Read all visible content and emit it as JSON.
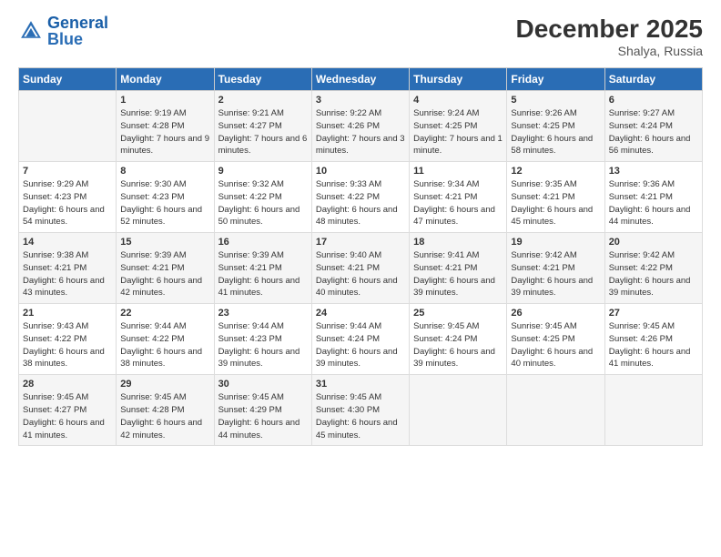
{
  "header": {
    "logo_general": "General",
    "logo_blue": "Blue",
    "main_title": "December 2025",
    "subtitle": "Shalya, Russia"
  },
  "columns": [
    "Sunday",
    "Monday",
    "Tuesday",
    "Wednesday",
    "Thursday",
    "Friday",
    "Saturday"
  ],
  "weeks": [
    [
      {
        "day": "",
        "sunrise": "",
        "sunset": "",
        "daylight": ""
      },
      {
        "day": "1",
        "sunrise": "Sunrise: 9:19 AM",
        "sunset": "Sunset: 4:28 PM",
        "daylight": "Daylight: 7 hours and 9 minutes."
      },
      {
        "day": "2",
        "sunrise": "Sunrise: 9:21 AM",
        "sunset": "Sunset: 4:27 PM",
        "daylight": "Daylight: 7 hours and 6 minutes."
      },
      {
        "day": "3",
        "sunrise": "Sunrise: 9:22 AM",
        "sunset": "Sunset: 4:26 PM",
        "daylight": "Daylight: 7 hours and 3 minutes."
      },
      {
        "day": "4",
        "sunrise": "Sunrise: 9:24 AM",
        "sunset": "Sunset: 4:25 PM",
        "daylight": "Daylight: 7 hours and 1 minute."
      },
      {
        "day": "5",
        "sunrise": "Sunrise: 9:26 AM",
        "sunset": "Sunset: 4:25 PM",
        "daylight": "Daylight: 6 hours and 58 minutes."
      },
      {
        "day": "6",
        "sunrise": "Sunrise: 9:27 AM",
        "sunset": "Sunset: 4:24 PM",
        "daylight": "Daylight: 6 hours and 56 minutes."
      }
    ],
    [
      {
        "day": "7",
        "sunrise": "Sunrise: 9:29 AM",
        "sunset": "Sunset: 4:23 PM",
        "daylight": "Daylight: 6 hours and 54 minutes."
      },
      {
        "day": "8",
        "sunrise": "Sunrise: 9:30 AM",
        "sunset": "Sunset: 4:23 PM",
        "daylight": "Daylight: 6 hours and 52 minutes."
      },
      {
        "day": "9",
        "sunrise": "Sunrise: 9:32 AM",
        "sunset": "Sunset: 4:22 PM",
        "daylight": "Daylight: 6 hours and 50 minutes."
      },
      {
        "day": "10",
        "sunrise": "Sunrise: 9:33 AM",
        "sunset": "Sunset: 4:22 PM",
        "daylight": "Daylight: 6 hours and 48 minutes."
      },
      {
        "day": "11",
        "sunrise": "Sunrise: 9:34 AM",
        "sunset": "Sunset: 4:21 PM",
        "daylight": "Daylight: 6 hours and 47 minutes."
      },
      {
        "day": "12",
        "sunrise": "Sunrise: 9:35 AM",
        "sunset": "Sunset: 4:21 PM",
        "daylight": "Daylight: 6 hours and 45 minutes."
      },
      {
        "day": "13",
        "sunrise": "Sunrise: 9:36 AM",
        "sunset": "Sunset: 4:21 PM",
        "daylight": "Daylight: 6 hours and 44 minutes."
      }
    ],
    [
      {
        "day": "14",
        "sunrise": "Sunrise: 9:38 AM",
        "sunset": "Sunset: 4:21 PM",
        "daylight": "Daylight: 6 hours and 43 minutes."
      },
      {
        "day": "15",
        "sunrise": "Sunrise: 9:39 AM",
        "sunset": "Sunset: 4:21 PM",
        "daylight": "Daylight: 6 hours and 42 minutes."
      },
      {
        "day": "16",
        "sunrise": "Sunrise: 9:39 AM",
        "sunset": "Sunset: 4:21 PM",
        "daylight": "Daylight: 6 hours and 41 minutes."
      },
      {
        "day": "17",
        "sunrise": "Sunrise: 9:40 AM",
        "sunset": "Sunset: 4:21 PM",
        "daylight": "Daylight: 6 hours and 40 minutes."
      },
      {
        "day": "18",
        "sunrise": "Sunrise: 9:41 AM",
        "sunset": "Sunset: 4:21 PM",
        "daylight": "Daylight: 6 hours and 39 minutes."
      },
      {
        "day": "19",
        "sunrise": "Sunrise: 9:42 AM",
        "sunset": "Sunset: 4:21 PM",
        "daylight": "Daylight: 6 hours and 39 minutes."
      },
      {
        "day": "20",
        "sunrise": "Sunrise: 9:42 AM",
        "sunset": "Sunset: 4:22 PM",
        "daylight": "Daylight: 6 hours and 39 minutes."
      }
    ],
    [
      {
        "day": "21",
        "sunrise": "Sunrise: 9:43 AM",
        "sunset": "Sunset: 4:22 PM",
        "daylight": "Daylight: 6 hours and 38 minutes."
      },
      {
        "day": "22",
        "sunrise": "Sunrise: 9:44 AM",
        "sunset": "Sunset: 4:22 PM",
        "daylight": "Daylight: 6 hours and 38 minutes."
      },
      {
        "day": "23",
        "sunrise": "Sunrise: 9:44 AM",
        "sunset": "Sunset: 4:23 PM",
        "daylight": "Daylight: 6 hours and 39 minutes."
      },
      {
        "day": "24",
        "sunrise": "Sunrise: 9:44 AM",
        "sunset": "Sunset: 4:24 PM",
        "daylight": "Daylight: 6 hours and 39 minutes."
      },
      {
        "day": "25",
        "sunrise": "Sunrise: 9:45 AM",
        "sunset": "Sunset: 4:24 PM",
        "daylight": "Daylight: 6 hours and 39 minutes."
      },
      {
        "day": "26",
        "sunrise": "Sunrise: 9:45 AM",
        "sunset": "Sunset: 4:25 PM",
        "daylight": "Daylight: 6 hours and 40 minutes."
      },
      {
        "day": "27",
        "sunrise": "Sunrise: 9:45 AM",
        "sunset": "Sunset: 4:26 PM",
        "daylight": "Daylight: 6 hours and 41 minutes."
      }
    ],
    [
      {
        "day": "28",
        "sunrise": "Sunrise: 9:45 AM",
        "sunset": "Sunset: 4:27 PM",
        "daylight": "Daylight: 6 hours and 41 minutes."
      },
      {
        "day": "29",
        "sunrise": "Sunrise: 9:45 AM",
        "sunset": "Sunset: 4:28 PM",
        "daylight": "Daylight: 6 hours and 42 minutes."
      },
      {
        "day": "30",
        "sunrise": "Sunrise: 9:45 AM",
        "sunset": "Sunset: 4:29 PM",
        "daylight": "Daylight: 6 hours and 44 minutes."
      },
      {
        "day": "31",
        "sunrise": "Sunrise: 9:45 AM",
        "sunset": "Sunset: 4:30 PM",
        "daylight": "Daylight: 6 hours and 45 minutes."
      },
      {
        "day": "",
        "sunrise": "",
        "sunset": "",
        "daylight": ""
      },
      {
        "day": "",
        "sunrise": "",
        "sunset": "",
        "daylight": ""
      },
      {
        "day": "",
        "sunrise": "",
        "sunset": "",
        "daylight": ""
      }
    ]
  ]
}
